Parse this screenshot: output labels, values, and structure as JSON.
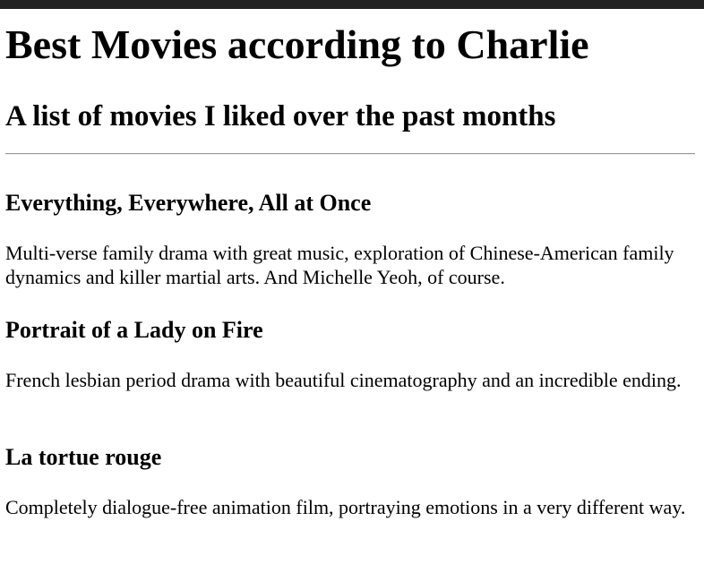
{
  "page": {
    "title": "Best Movies according to Charlie",
    "subtitle": "A list of movies I liked over the past months"
  },
  "movies": [
    {
      "title": "Everything, Everywhere, All at Once",
      "description": "Multi-verse family drama with great music, exploration of Chinese-American family dynamics and killer martial arts. And Michelle Yeoh, of course."
    },
    {
      "title": "Portrait of a Lady on Fire",
      "description": "French lesbian period drama with beautiful cinematography and an incredible ending."
    },
    {
      "title": "La tortue rouge",
      "description": "Completely dialogue-free animation film, portraying emotions in a very different way."
    }
  ]
}
